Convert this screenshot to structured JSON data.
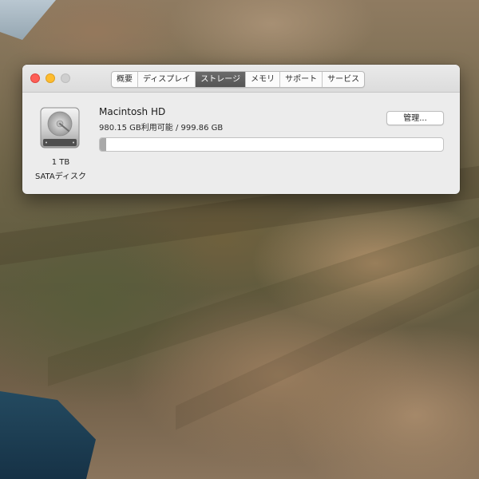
{
  "window": {
    "tabs": [
      {
        "label": "概要"
      },
      {
        "label": "ディスプレイ"
      },
      {
        "label": "ストレージ"
      },
      {
        "label": "メモリ"
      },
      {
        "label": "サポート"
      },
      {
        "label": "サービス"
      }
    ],
    "active_tab": "ストレージ"
  },
  "disk": {
    "name": "Macintosh HD",
    "usage_text": "980.15 GB利用可能 / 999.86 GB",
    "size_label": "1 TB",
    "type_label": "SATAディスク",
    "manage_label": "管理...",
    "used_fraction": 0.0197,
    "icon": "hard-drive-icon"
  },
  "colors": {
    "close": "#fe5f57",
    "minimize": "#febc2e",
    "zoom": "#cfcfcf",
    "tab_active": "#5e5e5e",
    "bar_used": "#a9a9a9"
  }
}
